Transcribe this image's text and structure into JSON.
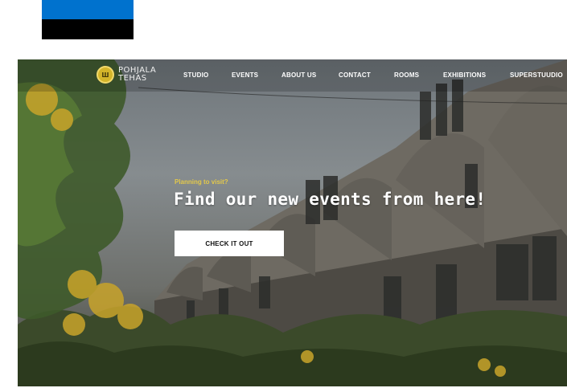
{
  "nav": {
    "logo_line1": "POHJALA",
    "logo_line2": "TEHAS",
    "items": [
      {
        "label": "STUDIO"
      },
      {
        "label": "EVENTS"
      },
      {
        "label": "ABOUT US"
      },
      {
        "label": "CONTACT"
      },
      {
        "label": "ROOMS"
      },
      {
        "label": "EXHIBITIONS"
      },
      {
        "label": "SUPERSTUUDIO"
      }
    ]
  },
  "hero": {
    "kicker": "Planning to visit?",
    "headline": "Find our new events from here!",
    "cta_label": "CHECK IT OUT"
  },
  "colors": {
    "flag_blue": "#0072CE",
    "flag_black": "#000000",
    "flag_white": "#FFFFFF",
    "accent_yellow": "#e3c84a"
  },
  "icons": {
    "logo": "pohjala-tehas-logo-icon",
    "flag": "estonia-flag-icon"
  }
}
